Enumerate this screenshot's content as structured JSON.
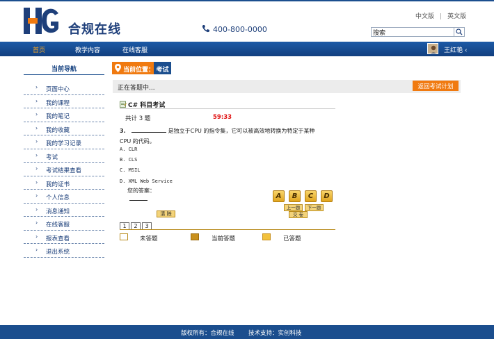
{
  "brand": {
    "name": "合规在线"
  },
  "header": {
    "phone": "400-800-0000",
    "lang_cn": "中文版",
    "lang_en": "英文版",
    "search_value": "搜索"
  },
  "nav": {
    "items": [
      "首页",
      "教学内容",
      "在线客服"
    ],
    "user_name": "王红艳",
    "user_caret": "‹"
  },
  "sidebar": {
    "title": "当前导航",
    "items": [
      "页面中心",
      "我的课程",
      "我的笔记",
      "我的收藏",
      "我的学习记录",
      "考试",
      "考试结果查看",
      "我的证书",
      "个人信息",
      "消息通知",
      "在线客服",
      "报表查看",
      "退出系统"
    ]
  },
  "breadcrumb": {
    "label": "当前位置：",
    "current": "考试"
  },
  "status": {
    "text": "正在答题中...",
    "back_button": "返回考试计划"
  },
  "exam": {
    "title": "C# 科目考试",
    "count": "共计 3 题",
    "timer": "59:33",
    "question_no": "3.",
    "question_text": "是独立于CPU 的指令集，它可以被高效地转换为特定于某种CPU 的代码。",
    "options": [
      "A. CLR",
      "B. CLS",
      "C. MSIL",
      "D. XML Web Service"
    ],
    "answer_label": "您的答案：",
    "choices": [
      "A",
      "B",
      "C",
      "D"
    ],
    "prev": "上一题",
    "next": "下一题",
    "submit": "交 卷",
    "clear": "清 除",
    "pages": [
      "1",
      "2",
      "3"
    ]
  },
  "legend": {
    "items": [
      {
        "label": "未答题",
        "color": "#ffffff"
      },
      {
        "label": "当前答题",
        "color": "#c8901e"
      },
      {
        "label": "已答题",
        "color": "#f2c13c"
      }
    ]
  },
  "footer": {
    "copyright": "版权所有：合规在线",
    "support": "技术支持：实创科技"
  },
  "colors": {
    "primary": "#1b4e8e",
    "accent": "#f07a10",
    "timer": "#e01010"
  }
}
